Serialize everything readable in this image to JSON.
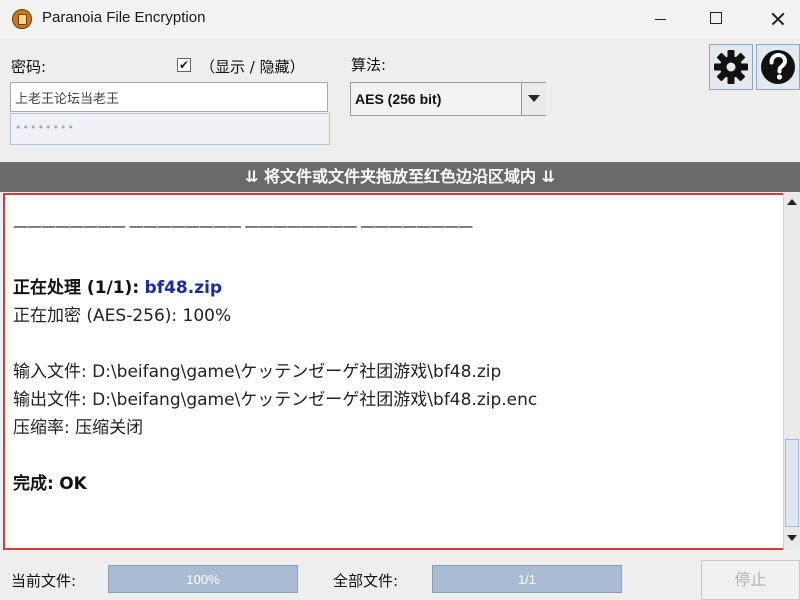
{
  "window": {
    "title": "Paranoia File Encryption"
  },
  "password": {
    "label": "密码:",
    "show_toggle_label": "（显示 / 隐藏）",
    "show_checked": true,
    "value": "上老王论坛当老王",
    "confirm_masked": "••••••••"
  },
  "algorithm": {
    "label": "算法:",
    "selected": "AES (256 bit)"
  },
  "drop_banner": "⇊ 将文件或文件夹拖放至红色边沿区域内 ⇊",
  "log": {
    "separator": "———————— ———————— ———————— ————————",
    "processing_label": "正在处理 (1/1):",
    "processing_file": "bf48.zip",
    "encrypting": "正在加密 (AES-256): 100%",
    "input_file": "输入文件: D:\\beifang\\game\\ケッテンゼーゲ社团游戏\\bf48.zip",
    "output_file": "输出文件: D:\\beifang\\game\\ケッテンゼーゲ社团游戏\\bf48.zip.enc",
    "compression": "压缩率: 压缩关闭",
    "done_label": "完成:",
    "done_status": "OK"
  },
  "status": {
    "current_label": "当前文件:",
    "current_progress_text": "100%",
    "current_progress": 1.0,
    "all_label": "全部文件:",
    "all_progress_text": "1/1",
    "all_progress": 1.0,
    "stop_label": "停止"
  },
  "icons": {
    "settings": "gear-icon",
    "help": "question-icon",
    "app": "app-icon"
  },
  "colors": {
    "drop_border": "#d83a3a",
    "banner_bg": "#6a6a6a",
    "file_link": "#1a2aa0",
    "progress_fill": "#9eb3cf"
  }
}
